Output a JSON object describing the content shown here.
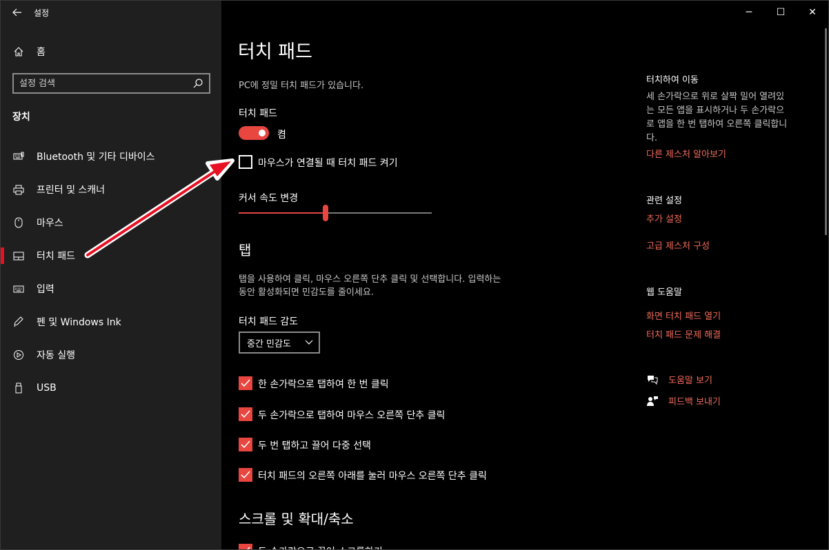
{
  "window": {
    "title": "설정",
    "controls": {
      "minimize": "─",
      "maximize": "☐",
      "close": "✕"
    }
  },
  "sidebar": {
    "home_label": "홈",
    "search_placeholder": "설정 검색",
    "section_label": "장치",
    "items": [
      {
        "label": "Bluetooth 및 기타 디바이스",
        "icon": "bluetooth-devices-icon"
      },
      {
        "label": "프린터 및 스캐너",
        "icon": "printer-icon"
      },
      {
        "label": "마우스",
        "icon": "mouse-icon"
      },
      {
        "label": "터치 패드",
        "icon": "touchpad-icon",
        "active": true
      },
      {
        "label": "입력",
        "icon": "keyboard-icon"
      },
      {
        "label": "펜 및 Windows Ink",
        "icon": "pen-icon"
      },
      {
        "label": "자동 실행",
        "icon": "autoplay-icon"
      },
      {
        "label": "USB",
        "icon": "usb-icon"
      }
    ]
  },
  "main": {
    "title": "터치 패드",
    "precision_note": "PC에 정밀 터치 패드가 있습니다.",
    "touchpad_label": "터치 패드",
    "toggle_state": "켬",
    "leave_on_label": "마우스가 연결될 때 터치 패드 켜기",
    "cursor_speed_label": "커서 속도 변경",
    "cursor_speed_fraction": 0.45,
    "taps_heading": "탭",
    "taps_desc_line1": "탭을 사용하여 클릭, 마우스 오른쪽 단추 클릭 및 선택합니다. 입력하는",
    "taps_desc_line2": "동안 활성화되면 민감도를 줄이세요.",
    "sensitivity_label": "터치 패드 감도",
    "sensitivity_value": "중간 민감도",
    "tap_options": [
      "한 손가락으로 탭하여 한 번 클릭",
      "두 손가락으로 탭하여 마우스 오른쪽 단추 클릭",
      "두 번 탭하고 끌어 다중 선택",
      "터치 패드의 오른쪽 아래를 눌러 마우스 오른쪽 단추 클릭"
    ],
    "scroll_heading": "스크롤 및 확대/축소",
    "scroll_option": "두 손가락으로 끌어 스크롤하기"
  },
  "right": {
    "nav_heading": "터치하여 이동",
    "nav_desc_lines": [
      "세 손가락으로 위로 살짝 밀어 열려있",
      "는 모든 앱을 표시하거나 두 손가락으",
      "로 앱을 한 번 탭하여 오른쪽 클릭합니",
      "다."
    ],
    "gestures_link": "다른 제스처 알아보기",
    "related_heading": "관련 설정",
    "additional_link": "추가 설정",
    "advanced_link": "고급 제스처 구성",
    "web_help_heading": "웹 도움말",
    "web_links": [
      "화면 터치 패드 열기",
      "터치 패드 문제 해결"
    ],
    "get_help": "도움말 보기",
    "feedback": "피드백 보내기"
  },
  "colors": {
    "accent": "#e8463f",
    "link": "#f26b5b",
    "sidebar_bg": "#1f1f1f"
  }
}
